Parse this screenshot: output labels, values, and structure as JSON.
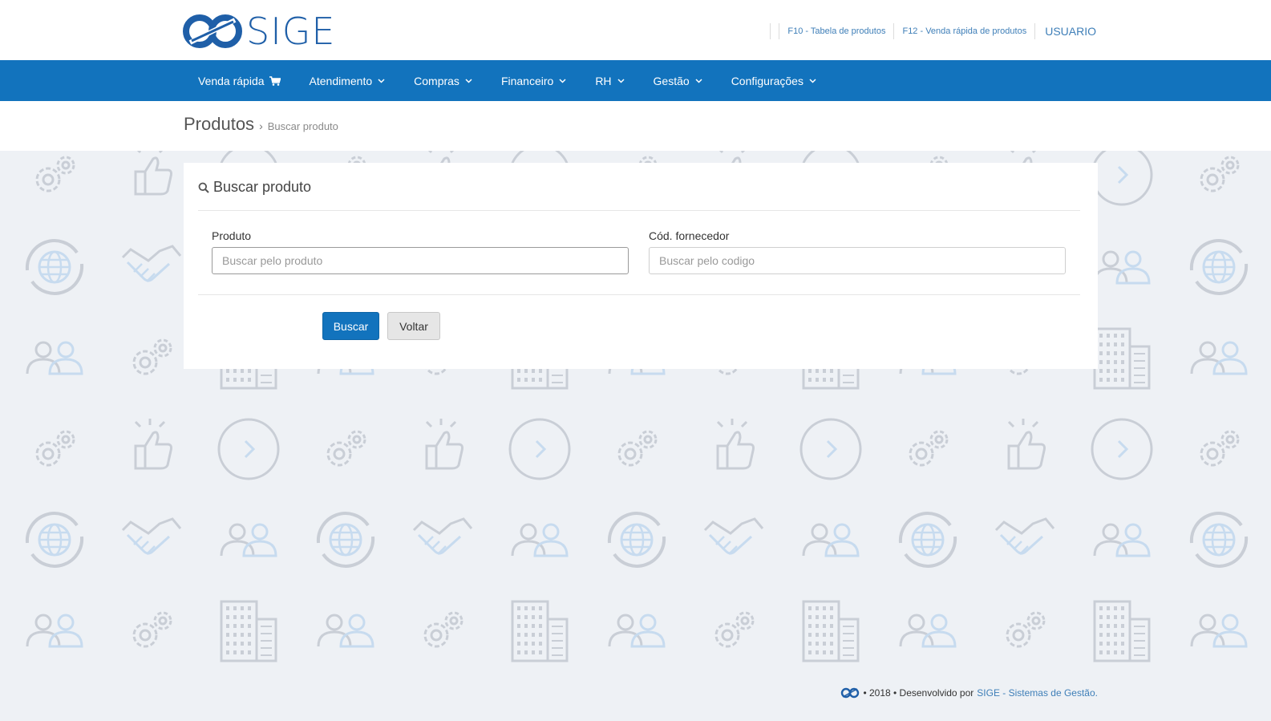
{
  "brand": {
    "logo_text": "SIGE",
    "accent": "#1273bd",
    "logo_color": "#1f5fa8"
  },
  "shortcuts": {
    "f10": "F10 - Tabela de produtos",
    "f12": "F12 - Venda rápida de produtos",
    "user": "USUARIO"
  },
  "nav": {
    "items": [
      {
        "label": "Venda rápida",
        "icon": "cart-icon"
      },
      {
        "label": "Atendimento",
        "icon": "chevron-down-icon"
      },
      {
        "label": "Compras",
        "icon": "chevron-down-icon"
      },
      {
        "label": "Financeiro",
        "icon": "chevron-down-icon"
      },
      {
        "label": "RH",
        "icon": "chevron-down-icon"
      },
      {
        "label": "Gestão",
        "icon": "chevron-down-icon"
      },
      {
        "label": "Configurações",
        "icon": "chevron-down-icon"
      }
    ]
  },
  "breadcrumb": {
    "title": "Produtos",
    "separator": "›",
    "current": "Buscar produto"
  },
  "card": {
    "title": "Buscar produto",
    "title_icon": "search-icon",
    "fields": {
      "produto": {
        "label": "Produto",
        "value": "",
        "placeholder": "Buscar pelo produto"
      },
      "codigo": {
        "label": "Cód. fornecedor",
        "value": "",
        "placeholder": "Buscar pelo codigo"
      }
    },
    "buttons": {
      "search": "Buscar",
      "back": "Voltar"
    }
  },
  "footer": {
    "text": "• 2018 • Desenvolvido por",
    "brand": "SIGE - Sistemas de Gestão."
  }
}
